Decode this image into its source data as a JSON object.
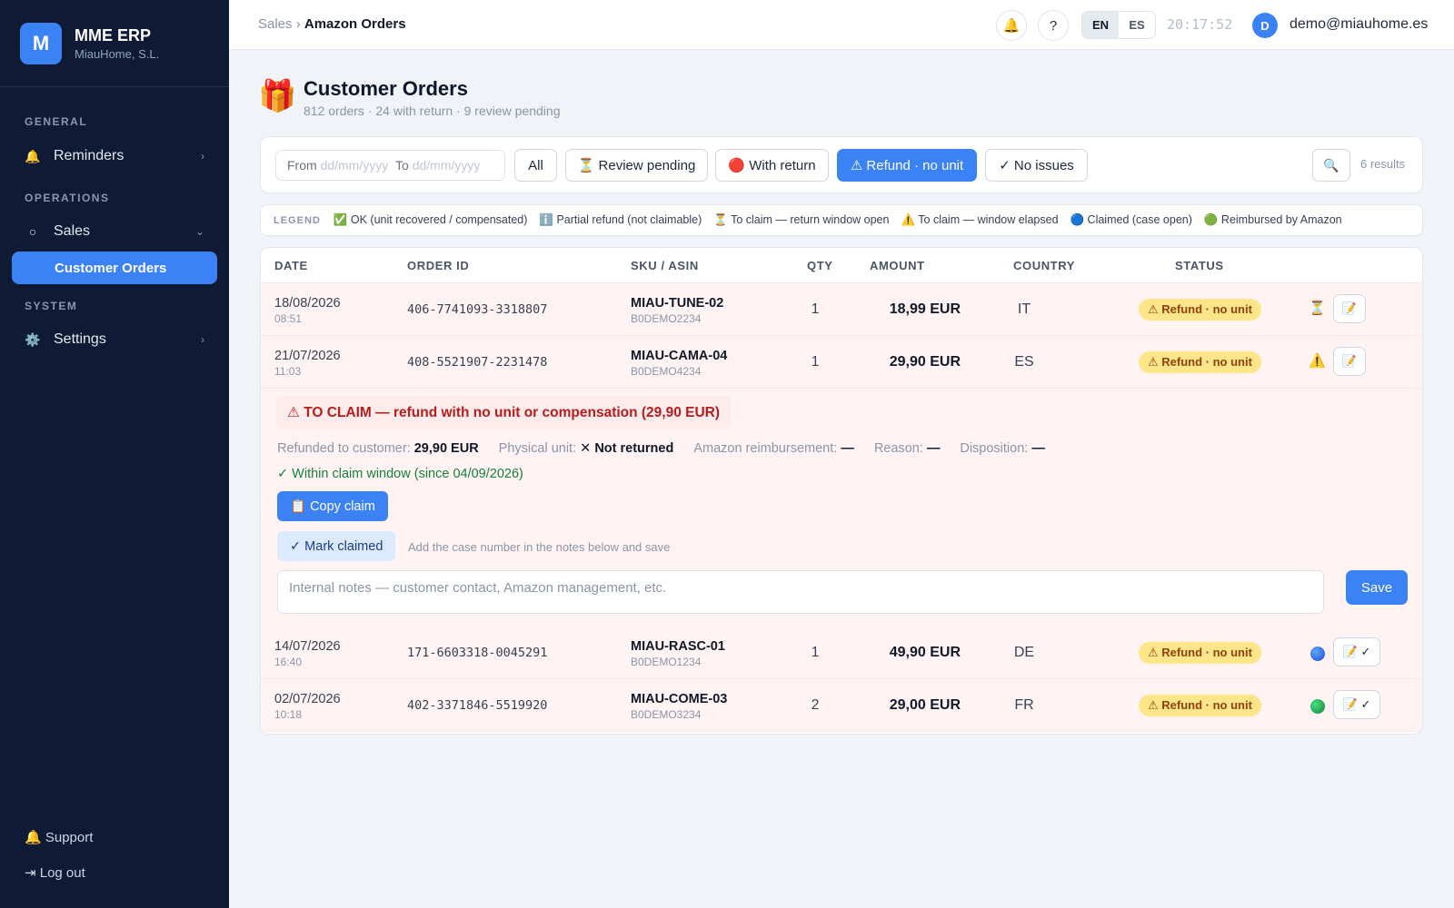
{
  "app": {
    "logo_letter": "M",
    "name": "MME ERP",
    "company": "MiauHome, S.L."
  },
  "sidebar": {
    "sections": {
      "general": "GENERAL",
      "operations": "OPERATIONS",
      "system": "SYSTEM"
    },
    "items": {
      "reminders": {
        "label": "Reminders",
        "icon": "bell-icon",
        "glyph": "🔔",
        "chev": "›"
      },
      "sales": {
        "label": "Sales",
        "icon": "circle-icon",
        "glyph": "○",
        "chev": "⌄"
      },
      "customer_orders": {
        "label": "Customer Orders"
      },
      "settings": {
        "label": "Settings",
        "icon": "gear-icon",
        "glyph": "⚙️",
        "chev": "›"
      }
    },
    "support": "🔔 Support",
    "logout": "⇥ Log out"
  },
  "topbar": {
    "breadcrumb_parent": "Sales",
    "breadcrumb_sep": "›",
    "breadcrumb_current": "Amazon Orders",
    "bell_glyph": "🔔",
    "help_glyph": "?",
    "lang_options": [
      "EN",
      "ES"
    ],
    "lang_selected": "EN",
    "clock": "20:17:52",
    "avatar_letter": "D",
    "user_email": "demo@miauhome.es"
  },
  "page": {
    "icon_glyph": "🎁",
    "title": "Customer Orders",
    "subtitle": "812 orders · 24 with return · 9 review pending"
  },
  "filters": {
    "from_label": "From",
    "from_placeholder": "dd/mm/yyyy",
    "to_label": "To",
    "to_placeholder": "dd/mm/yyyy",
    "buttons": {
      "all": "All",
      "review": "⏳ Review pending",
      "return": "🔴 With return",
      "refund": "⚠ Refund · no unit",
      "no_issues": "✓ No issues"
    },
    "active": "refund",
    "search_glyph": "🔍",
    "results": "6 results"
  },
  "legend": {
    "title": "LEGEND",
    "items": [
      "✅ OK (unit recovered / compensated)",
      "ℹ️ Partial refund (not claimable)",
      "⏳ To claim — return window open",
      "⚠️ To claim — window elapsed",
      "🔵 Claimed (case open)",
      "🟢 Reimbursed by Amazon"
    ]
  },
  "table": {
    "columns": [
      "DATE",
      "ORDER ID",
      "SKU / ASIN",
      "QTY",
      "AMOUNT",
      "COUNTRY",
      "STATUS"
    ],
    "rows": [
      {
        "date": "18/08/2026",
        "time": "08:51",
        "order_id": "406-7741093-3318807",
        "sku": "MIAU-TUNE-02",
        "asin": "B0DEMO2234",
        "qty": "1",
        "amount": "18,99 EUR",
        "country": "IT",
        "status": "⚠ Refund · no unit",
        "flag": "⏳",
        "action": "📝"
      },
      {
        "date": "21/07/2026",
        "time": "11:03",
        "order_id": "408-5521907-2231478",
        "sku": "MIAU-CAMA-04",
        "asin": "B0DEMO4234",
        "qty": "1",
        "amount": "29,90 EUR",
        "country": "ES",
        "status": "⚠ Refund · no unit",
        "flag": "⚠️",
        "action": "📝"
      },
      {
        "date": "14/07/2026",
        "time": "16:40",
        "order_id": "171-6603318-0045291",
        "sku": "MIAU-RASC-01",
        "asin": "B0DEMO1234",
        "qty": "1",
        "amount": "49,90 EUR",
        "country": "DE",
        "status": "⚠ Refund · no unit",
        "flag": "blue-circle",
        "action": "📝 ✓"
      },
      {
        "date": "02/07/2026",
        "time": "10:18",
        "order_id": "402-3371846-5519920",
        "sku": "MIAU-COME-03",
        "asin": "B0DEMO3234",
        "qty": "2",
        "amount": "29,00 EUR",
        "country": "FR",
        "status": "⚠ Refund · no unit",
        "flag": "green-circle",
        "action": "📝 ✓"
      }
    ]
  },
  "expanded": {
    "title": "⚠ TO CLAIM — refund with no unit or compensation (29,90 EUR)",
    "refunded_label": "Refunded to customer:",
    "refunded_value": "29,90 EUR",
    "physical_label": "Physical unit:",
    "physical_value": "✕ Not returned",
    "reimb_label": "Amazon reimbursement:",
    "reimb_value": "—",
    "reason_label": "Reason:",
    "reason_value": "—",
    "disp_label": "Disposition:",
    "disp_value": "—",
    "window": "✓ Within claim window (since 04/09/2026)",
    "copy_btn": "📋 Copy claim",
    "mark_btn": "✓ Mark claimed",
    "mark_hint": "Add the case number in the notes below and save",
    "notes_placeholder": "Internal notes — customer contact, Amazon management, etc.",
    "save_btn": "Save"
  }
}
